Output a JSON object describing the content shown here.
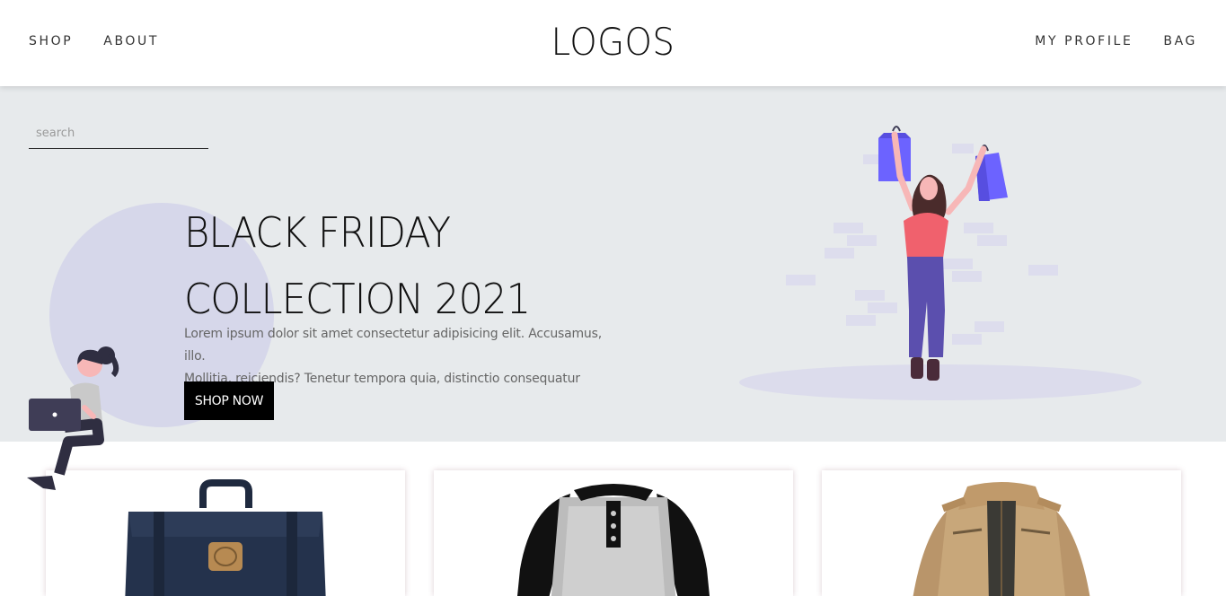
{
  "header": {
    "nav_left": [
      {
        "label": "SHOP"
      },
      {
        "label": "ABOUT"
      }
    ],
    "logo": "LOGOS",
    "nav_right": [
      {
        "label": "MY PROFILE"
      },
      {
        "label": "BAG"
      }
    ]
  },
  "search": {
    "placeholder": "search"
  },
  "hero": {
    "title_line1": "BLACK FRIDAY",
    "title_line2": "COLLECTION 2021",
    "text_line1": "Lorem ipsum dolor sit amet consectetur adipisicing elit. Accusamus, illo.",
    "text_line2": "Mollitia, reiciendis? Tenetur tempora quia, distinctio consequatur",
    "cta_label": "SHOP NOW"
  },
  "products": [
    {
      "image": "navy-backpack"
    },
    {
      "image": "raglan-henley-shirt"
    },
    {
      "image": "khaki-jacket"
    }
  ],
  "colors": {
    "hero_bg": "#e7eaec",
    "circle": "#d6d7ea",
    "bag_purple": "#6c63ff",
    "shirt_pink": "#f0616d",
    "pants_purple": "#5b4fae"
  }
}
